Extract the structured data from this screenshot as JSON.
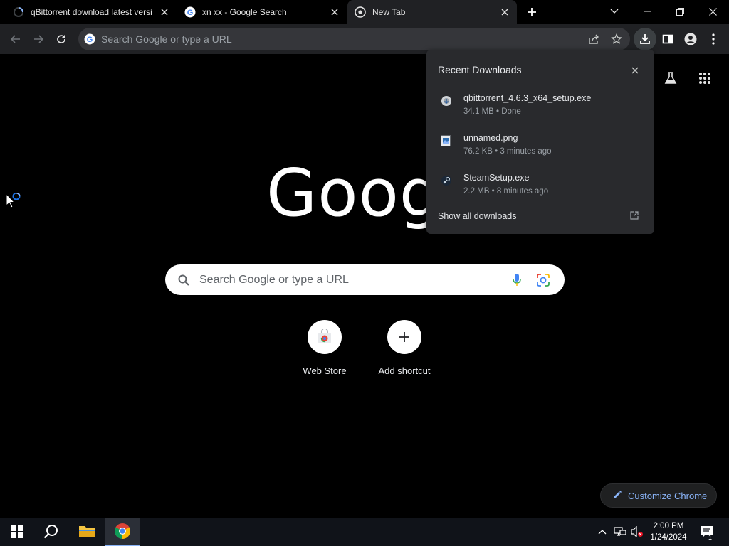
{
  "tabs": [
    {
      "title": "qBittorrent download latest versi",
      "active": false,
      "favicon": "loading-spinner-icon"
    },
    {
      "title": "xn xx - Google Search",
      "active": false,
      "favicon": "google-g-icon"
    },
    {
      "title": "New Tab",
      "active": true,
      "favicon": "chrome-icon"
    }
  ],
  "toolbar": {
    "omnibox_placeholder": "Search Google or type a URL"
  },
  "ntp": {
    "logo_text": "Google",
    "search_placeholder": "Search Google or type a URL",
    "shortcuts": [
      {
        "label": "Web Store",
        "icon": "web-store-icon"
      },
      {
        "label": "Add shortcut",
        "icon": "plus-icon"
      }
    ],
    "customize_label": "Customize Chrome"
  },
  "downloads": {
    "title": "Recent Downloads",
    "items": [
      {
        "name": "qbittorrent_4.6.3_x64_setup.exe",
        "meta": "34.1 MB • Done",
        "icon": "installer-icon"
      },
      {
        "name": "unnamed.png",
        "meta": "76.2 KB • 3 minutes ago",
        "icon": "image-file-icon"
      },
      {
        "name": "SteamSetup.exe",
        "meta": "2.2 MB • 8 minutes ago",
        "icon": "steam-icon"
      }
    ],
    "show_all": "Show all downloads"
  },
  "taskbar": {
    "time": "2:00 PM",
    "date": "1/24/2024",
    "notification_count": "1"
  },
  "colors": {
    "accent": "#8ab4f8",
    "toolbar_bg": "#202124",
    "bubble_bg": "#292a2d"
  }
}
